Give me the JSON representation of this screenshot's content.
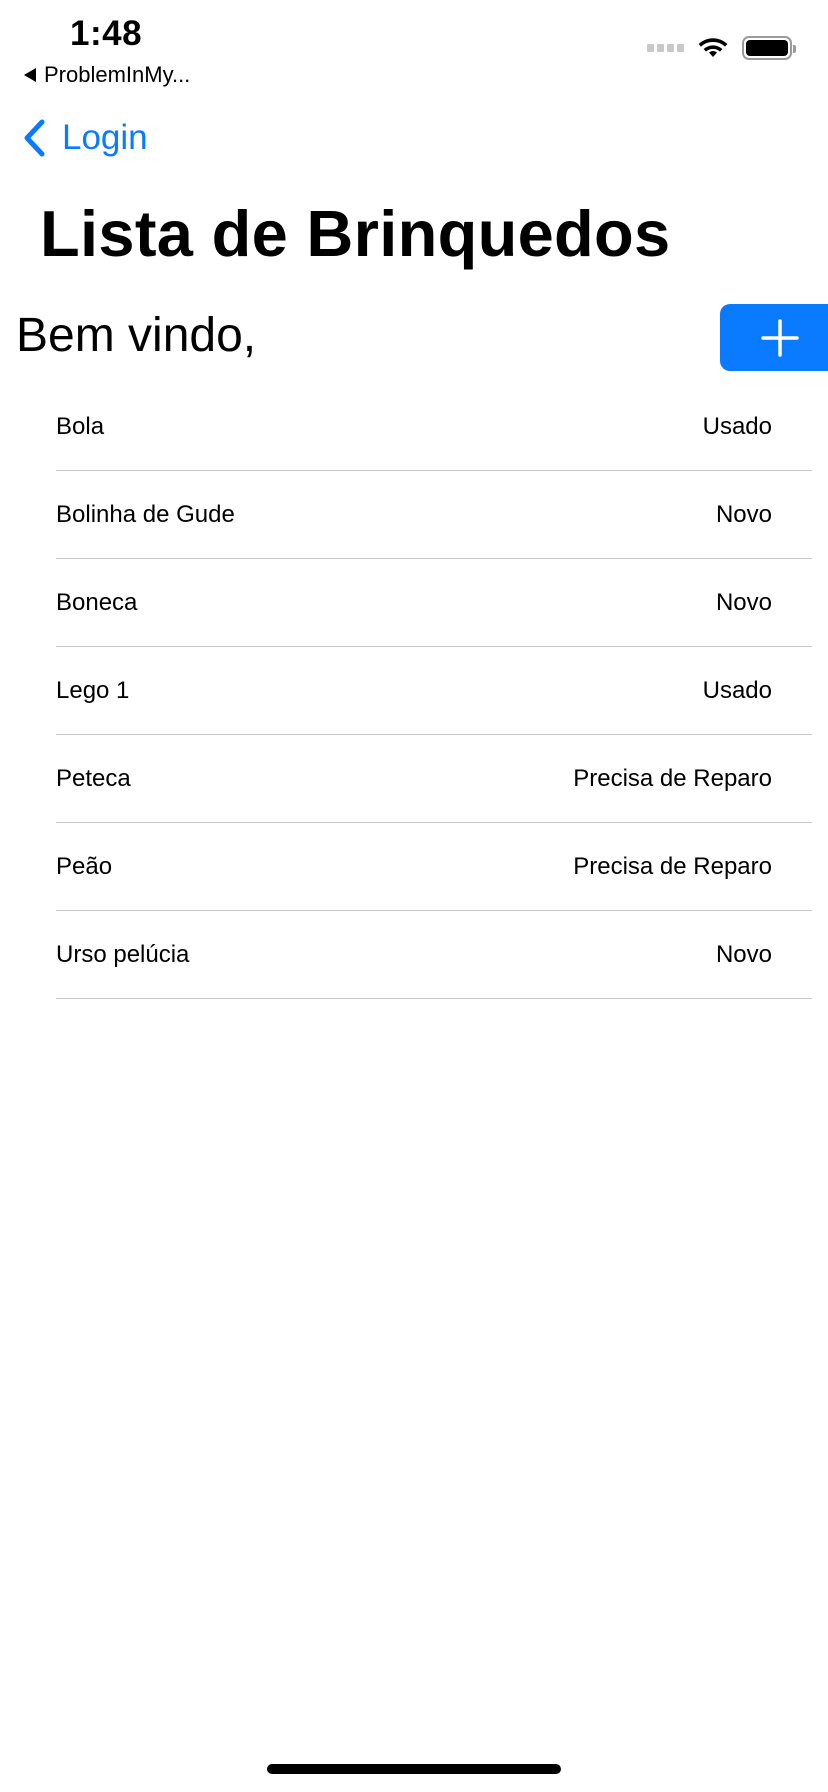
{
  "status_bar": {
    "time": "1:48",
    "back_app": "ProblemInMy..."
  },
  "nav": {
    "back_label": "Login",
    "title": "Lista de Brinquedos"
  },
  "welcome": {
    "text": "Bem vindo,"
  },
  "colors": {
    "accent": "#0a7aff",
    "separator": "#c8c7cc"
  },
  "toys": [
    {
      "name": "Bola",
      "status": "Usado"
    },
    {
      "name": "Bolinha de Gude",
      "status": "Novo"
    },
    {
      "name": "Boneca",
      "status": "Novo"
    },
    {
      "name": "Lego 1",
      "status": "Usado"
    },
    {
      "name": "Peteca",
      "status": "Precisa de Reparo"
    },
    {
      "name": "Peão",
      "status": "Precisa de Reparo"
    },
    {
      "name": "Urso pelúcia",
      "status": "Novo"
    }
  ]
}
